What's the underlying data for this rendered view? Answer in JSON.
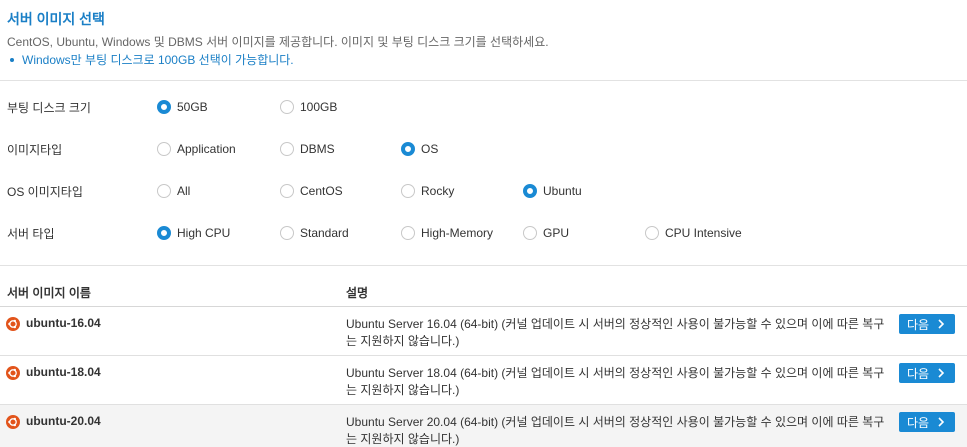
{
  "header": {
    "title": "서버 이미지 선택",
    "description": "CentOS, Ubuntu, Windows 및 DBMS 서버 이미지를 제공합니다. 이미지 및 부팅 디스크 크기를 선택하세요.",
    "note": "Windows만 부팅 디스크로 100GB 선택이 가능합니다."
  },
  "options": {
    "boot_disk": {
      "label": "부팅 디스크 크기",
      "items": [
        {
          "text": "50GB",
          "selected": true
        },
        {
          "text": "100GB",
          "selected": false
        }
      ]
    },
    "image_type": {
      "label": "이미지타입",
      "items": [
        {
          "text": "Application",
          "selected": false
        },
        {
          "text": "DBMS",
          "selected": false
        },
        {
          "text": "OS",
          "selected": true
        }
      ]
    },
    "os_image_type": {
      "label": "OS 이미지타입",
      "items": [
        {
          "text": "All",
          "selected": false
        },
        {
          "text": "CentOS",
          "selected": false
        },
        {
          "text": "Rocky",
          "selected": false
        },
        {
          "text": "Ubuntu",
          "selected": true
        }
      ]
    },
    "server_type": {
      "label": "서버 타입",
      "items": [
        {
          "text": "High CPU",
          "selected": true
        },
        {
          "text": "Standard",
          "selected": false
        },
        {
          "text": "High-Memory",
          "selected": false
        },
        {
          "text": "GPU",
          "selected": false
        },
        {
          "text": "CPU Intensive",
          "selected": false
        }
      ]
    }
  },
  "table": {
    "col_name": "서버 이미지 이름",
    "col_desc": "설명",
    "rows": [
      {
        "icon": "ubuntu-icon",
        "name": "ubuntu-16.04",
        "desc": "Ubuntu Server 16.04 (64-bit) (커널 업데이트 시 서버의 정상적인 사용이 불가능할 수 있으며 이에 따른 복구는 지원하지 않습니다.)",
        "button": "다음"
      },
      {
        "icon": "ubuntu-icon",
        "name": "ubuntu-18.04",
        "desc": "Ubuntu Server 18.04 (64-bit) (커널 업데이트 시 서버의 정상적인 사용이 불가능할 수 있으며 이에 따른 복구는 지원하지 않습니다.)",
        "button": "다음"
      },
      {
        "icon": "ubuntu-icon",
        "name": "ubuntu-20.04",
        "desc": "Ubuntu Server 20.04 (64-bit) (커널 업데이트 시 서버의 정상적인 사용이 불가능할 수 있으며 이에 따른 복구는 지원하지 않습니다.)",
        "button": "다음"
      }
    ]
  },
  "colors": {
    "accent": "#1a8ad4",
    "title": "#1a7fc6",
    "ubuntu": "#e2541b"
  }
}
